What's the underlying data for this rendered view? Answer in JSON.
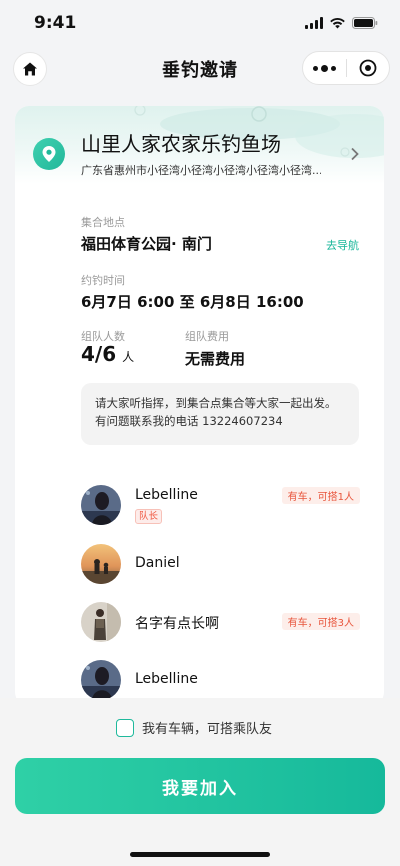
{
  "status": {
    "time": "9:41"
  },
  "nav": {
    "title": "垂钓邀请"
  },
  "place": {
    "name": "山里人家农家乐钓鱼场",
    "address": "广东省惠州市小径湾小径湾小径湾小径湾小径湾..."
  },
  "meeting": {
    "label": "集合地点",
    "value": "福田体育公园· 南门",
    "nav_link": "去导航"
  },
  "time": {
    "label": "约钓时间",
    "value": "6月7日 6:00 至 6月8日 16:00"
  },
  "team": {
    "count_label": "组队人数",
    "count_value": "4/6",
    "count_unit": "人",
    "fee_label": "组队费用",
    "fee_value": "无需费用"
  },
  "notice": {
    "line1": "请大家听指挥，到集合点集合等大家一起出发。",
    "line2": "有问题联系我的电话 13224607234"
  },
  "members": [
    {
      "name": "Lebelline",
      "role": "队长",
      "car": "有车，可搭1人"
    },
    {
      "name": "Daniel",
      "role": "",
      "car": ""
    },
    {
      "name": "名字有点长啊",
      "role": "",
      "car": "有车，可搭3人"
    },
    {
      "name": "Lebelline",
      "role": "",
      "car": ""
    }
  ],
  "bottom": {
    "car_option": "我有车辆，可搭乘队友",
    "join_button": "我要加入"
  },
  "colors": {
    "accent": "#1fb99c",
    "warning": "#e8553c"
  }
}
